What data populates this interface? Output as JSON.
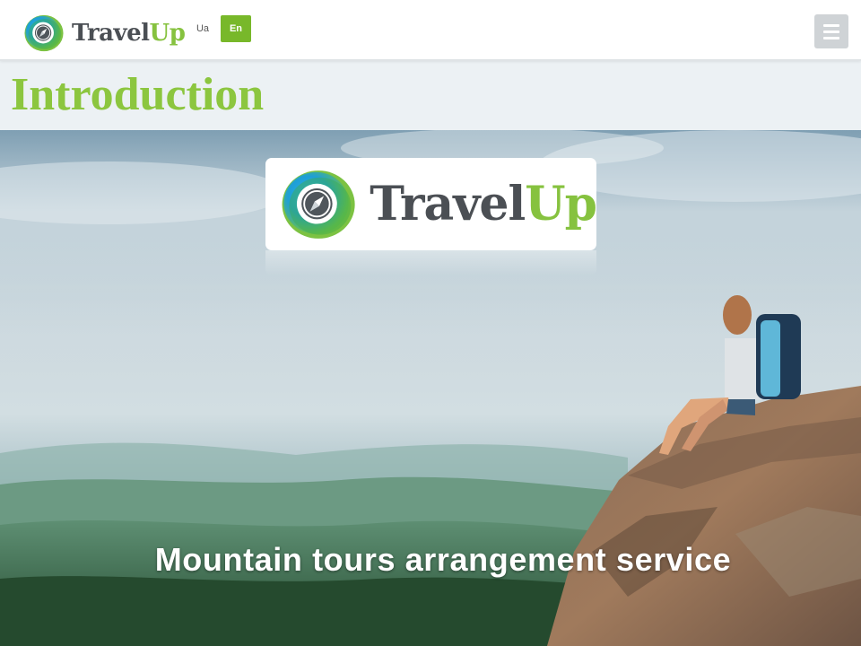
{
  "header": {
    "brand": {
      "travel": "Travel",
      "up": "Up"
    },
    "languages": [
      {
        "label": "Ua",
        "active": false
      },
      {
        "label": "En",
        "active": true
      }
    ],
    "menu_icon": "hamburger-menu-icon"
  },
  "page": {
    "title": "Introduction"
  },
  "hero": {
    "logo": {
      "travel": "Travel",
      "up": "Up",
      "icon": "compass-icon"
    },
    "tagline": "Mountain tours arrangement service"
  },
  "colors": {
    "brand_green": "#86c23f",
    "brand_gray": "#4b4f54",
    "active_lang_bg": "#78b82a",
    "title_band_bg": "#ecf1f4"
  }
}
